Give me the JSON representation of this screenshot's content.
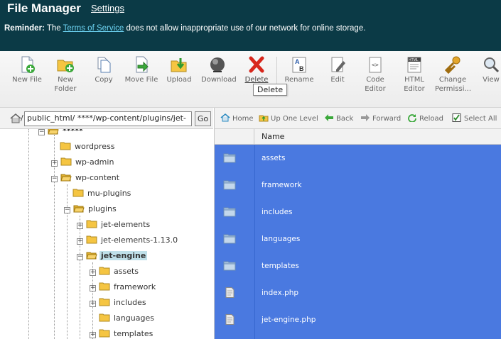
{
  "header": {
    "title": "File Manager",
    "settings_link": "Settings",
    "reminder_label": "Reminder:",
    "reminder_pre": " The ",
    "tos_link": "Terms of Service",
    "reminder_post": " does not allow inappropriate use of our network for online storage."
  },
  "toolbar": {
    "new_file": [
      "New File"
    ],
    "new_folder": [
      "New",
      "Folder"
    ],
    "copy": [
      "Copy"
    ],
    "move_file": [
      "Move File"
    ],
    "upload": [
      "Upload"
    ],
    "download": [
      "Download"
    ],
    "delete": [
      "Delete"
    ],
    "rename": [
      "Rename"
    ],
    "edit": [
      "Edit"
    ],
    "code_editor": [
      "Code",
      "Editor"
    ],
    "html_editor": [
      "HTML",
      "Editor"
    ],
    "change_permissions": [
      "Change",
      "Permissi..."
    ],
    "view": [
      "View"
    ],
    "tooltip": "Delete"
  },
  "pathbar": {
    "path_value": "public_html/ ****/wp-content/plugins/jet-",
    "go_label": "Go"
  },
  "navbar": {
    "home": "Home",
    "up_one_level": "Up One Level",
    "back": "Back",
    "forward": "Forward",
    "reload": "Reload",
    "select_all": "Select All"
  },
  "tree": {
    "root": "*****",
    "wordpress": "wordpress",
    "wp_admin": "wp-admin",
    "wp_content": "wp-content",
    "mu_plugins": "mu-plugins",
    "plugins": "plugins",
    "jet_elements": "jet-elements",
    "jet_elements_113": "jet-elements-1.13.0",
    "jet_engine": "jet-engine",
    "assets": "assets",
    "framework": "framework",
    "includes": "includes",
    "languages": "languages",
    "templates": "templates"
  },
  "filelist": {
    "column_name": "Name",
    "rows": [
      {
        "name": "assets",
        "type": "folder"
      },
      {
        "name": "framework",
        "type": "folder"
      },
      {
        "name": "includes",
        "type": "folder"
      },
      {
        "name": "languages",
        "type": "folder"
      },
      {
        "name": "templates",
        "type": "folder"
      },
      {
        "name": "index.php",
        "type": "file"
      },
      {
        "name": "jet-engine.php",
        "type": "file"
      }
    ]
  },
  "colors": {
    "header_bg": "#0b3a46",
    "link": "#6dd3f2",
    "selection_blue": "#4a79e0",
    "tree_selected": "#bfe0e9",
    "folder_yellow": "#f5c542"
  }
}
